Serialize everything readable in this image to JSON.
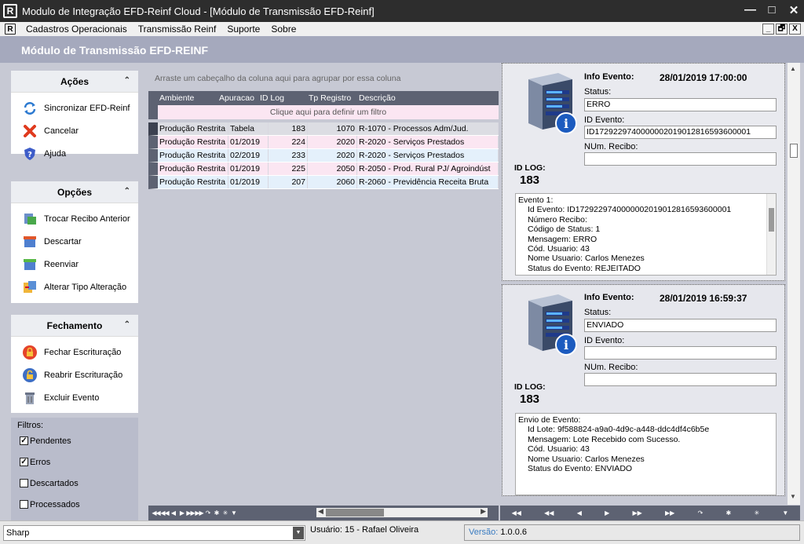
{
  "window": {
    "title": "Modulo de Integração EFD-Reinf Cloud - [Módulo de Transmissão EFD-Reinf]",
    "logo_letter": "R",
    "controls": [
      "—",
      "□",
      "✕"
    ]
  },
  "menu": {
    "items": [
      "Cadastros Operacionais",
      "Transmissão Reinf",
      "Suporte",
      "Sobre"
    ],
    "mdi_controls": [
      "_",
      "🗗",
      "X"
    ]
  },
  "header": {
    "title": "Módulo de Transmissão EFD-REINF"
  },
  "sidebar": {
    "acoes": {
      "title": "Ações",
      "items": [
        {
          "label": "Sincronizar EFD-Reinf",
          "icon": "sync-icon"
        },
        {
          "label": "Cancelar",
          "icon": "cancel-x-icon"
        },
        {
          "label": "Ajuda",
          "icon": "help-shield-icon"
        }
      ]
    },
    "opcoes": {
      "title": "Opções",
      "items": [
        {
          "label": "Trocar Recibo Anterior",
          "icon": "swap-receipt-icon"
        },
        {
          "label": "Descartar",
          "icon": "discard-box-icon"
        },
        {
          "label": "Reenviar",
          "icon": "resend-box-icon"
        },
        {
          "label": "Alterar Tipo Alteração",
          "icon": "change-type-icon"
        }
      ]
    },
    "fechamento": {
      "title": "Fechamento",
      "items": [
        {
          "label": "Fechar Escrituração",
          "icon": "lock-closed-icon"
        },
        {
          "label": "Reabrir Escrituração",
          "icon": "lock-open-icon"
        },
        {
          "label": "Excluir Evento",
          "icon": "delete-event-icon"
        }
      ]
    },
    "filtros": {
      "title": "Filtros:",
      "items": [
        {
          "label": "Pendentes",
          "checked": true
        },
        {
          "label": "Erros",
          "checked": true
        },
        {
          "label": "Descartados",
          "checked": false
        },
        {
          "label": "Processados",
          "checked": false
        }
      ]
    }
  },
  "grid": {
    "group_hint": "Arraste um cabeçalho da coluna aqui para agrupar por essa coluna",
    "filter_hint": "Clique aqui para definir um filtro",
    "columns": [
      "Ambiente",
      "Apuracao",
      "ID Log",
      "Tp Registro",
      "Descrição"
    ],
    "rows": [
      {
        "ambiente": "Produção Restrita",
        "apuracao": "Tabela",
        "id_log": "183",
        "tp_registro": "1070",
        "descricao": "R-1070 - Processos Adm/Jud.",
        "bg": "#dcdde3"
      },
      {
        "ambiente": "Produção Restrita",
        "apuracao": "01/2019",
        "id_log": "224",
        "tp_registro": "2020",
        "descricao": "R-2020 - Serviços Prestados",
        "bg": "#fbe6f2"
      },
      {
        "ambiente": "Produção Restrita",
        "apuracao": "02/2019",
        "id_log": "233",
        "tp_registro": "2020",
        "descricao": "R-2020 - Serviços Prestados",
        "bg": "#e4f0fb"
      },
      {
        "ambiente": "Produção Restrita",
        "apuracao": "01/2019",
        "id_log": "225",
        "tp_registro": "2050",
        "descricao": "R-2050 - Prod. Rural PJ/ Agroindúst",
        "bg": "#fbe6f2"
      },
      {
        "ambiente": "Produção Restrita",
        "apuracao": "01/2019",
        "id_log": "207",
        "tp_registro": "2060",
        "descricao": "R-2060 - Previdência Receita Bruta",
        "bg": "#e4f0fb"
      }
    ]
  },
  "events": [
    {
      "info_label": "Info Evento:",
      "date": "28/01/2019 17:00:00",
      "status_label": "Status:",
      "status": "ERRO",
      "id_evento_label": "ID Evento:",
      "id_evento": "ID1729229740000002019012816593600001",
      "num_recibo_label": "NUm. Recibo:",
      "num_recibo": "",
      "id_log_label": "ID LOG:",
      "id_log": "183",
      "log_lines": [
        {
          "t": "Evento 1:",
          "i": false
        },
        {
          "t": "Id Evento: ID1729229740000002019012816593600001",
          "i": true
        },
        {
          "t": "Número Recibo:",
          "i": true
        },
        {
          "t": "Código de Status: 1",
          "i": true
        },
        {
          "t": "Mensagem: ERRO",
          "i": true
        },
        {
          "t": "Cód. Usuario: 43",
          "i": true
        },
        {
          "t": "Nome Usuario: Carlos Menezes",
          "i": true
        },
        {
          "t": "Status do Evento: REJEITADO",
          "i": true
        }
      ]
    },
    {
      "info_label": "Info Evento:",
      "date": "28/01/2019 16:59:37",
      "status_label": "Status:",
      "status": "ENVIADO",
      "id_evento_label": "ID Evento:",
      "id_evento": "",
      "num_recibo_label": "NUm. Recibo:",
      "num_recibo": "",
      "id_log_label": "ID LOG:",
      "id_log": "183",
      "log_lines": [
        {
          "t": "Envio de Evento:",
          "i": false
        },
        {
          "t": "Id Lote: 9f588824-a9a0-4d9c-a448-ddc4df4c6b5e",
          "i": true
        },
        {
          "t": "Mensagem: Lote Recebido com Sucesso.",
          "i": true
        },
        {
          "t": "Cód. Usuario: 43",
          "i": true
        },
        {
          "t": "Nome Usuario: Carlos Menezes",
          "i": true
        },
        {
          "t": "Status do Evento: ENVIADO",
          "i": true
        }
      ]
    }
  ],
  "status_bar": {
    "combo_value": "Sharp",
    "user": "Usuário: 15 - Rafael Oliveira",
    "version_label": "Versão:",
    "version": "1.0.0.6"
  },
  "colors": {
    "header_bg": "#a5a9bd",
    "grid_header": "#5d6272",
    "row_pink": "#fbe6f2",
    "row_blue": "#e4f0fb",
    "version_label": "#3a7cc1"
  }
}
